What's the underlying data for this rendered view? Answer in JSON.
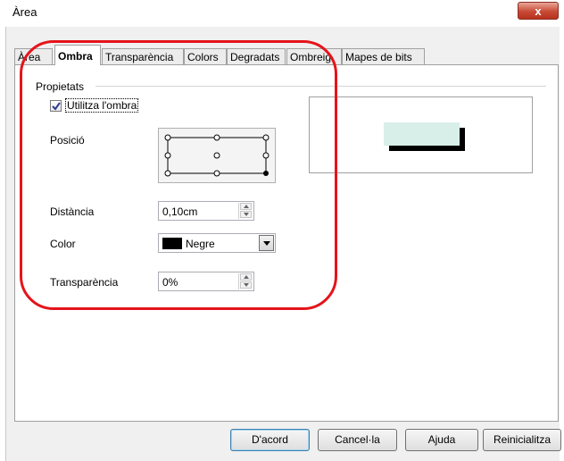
{
  "window": {
    "title": "Àrea",
    "close_label": "x"
  },
  "tabs": [
    {
      "label": "Àrea",
      "active": false
    },
    {
      "label": "Ombra",
      "active": true
    },
    {
      "label": "Transparència",
      "active": false
    },
    {
      "label": "Colors",
      "active": false
    },
    {
      "label": "Degradats",
      "active": false
    },
    {
      "label": "Ombreig",
      "active": false
    },
    {
      "label": "Mapes de bits",
      "active": false
    }
  ],
  "properties": {
    "group_label": "Propietats",
    "use_shadow": {
      "label": "Utilitza l'ombra",
      "checked": true
    },
    "position": {
      "label": "Posició",
      "selected": "bottom-right"
    },
    "distance": {
      "label": "Distància",
      "value": "0,10cm"
    },
    "color": {
      "label": "Color",
      "value": "Negre",
      "swatch": "#000000"
    },
    "transparency": {
      "label": "Transparència",
      "value": "0%"
    }
  },
  "preview": {
    "shape_color": "#d8eee9",
    "shadow_color": "#000000"
  },
  "buttons": {
    "ok": "D'acord",
    "cancel": "Cancel·la",
    "help": "Ajuda",
    "reset": "Reinicialitza"
  },
  "highlight_color": "#e5141b"
}
